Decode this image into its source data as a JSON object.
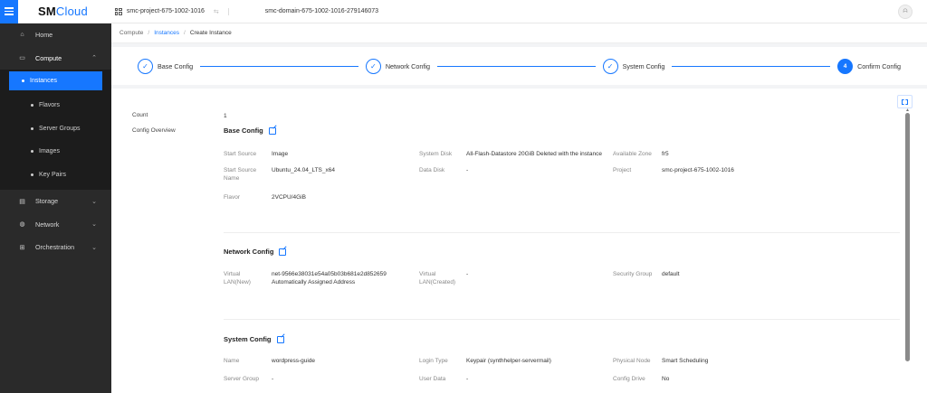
{
  "app": {
    "brand_bold": "SM",
    "brand_light": "Cloud"
  },
  "topbar": {
    "project": "smc-project-675-1002-1016",
    "domain": "smc-domain-675-1002-1016-279146073",
    "swap_glyph": "⇆",
    "sep_glyph": "|",
    "avatar_glyph": "ᗩ"
  },
  "sidebar": {
    "home": "Home",
    "compute": "Compute",
    "compute_items": [
      "Instances",
      "Flavors",
      "Server Groups",
      "Images",
      "Key Pairs"
    ],
    "storage": "Storage",
    "network": "Network",
    "orchestration": "Orchestration",
    "chev_up": "⌃",
    "chev_down": "⌄"
  },
  "breadcrumb": {
    "root": "Compute",
    "link": "Instances",
    "current": "Create Instance",
    "sep": "/"
  },
  "steps": [
    {
      "label": "Base Config",
      "mark": "✓"
    },
    {
      "label": "Network Config",
      "mark": "✓"
    },
    {
      "label": "System Config",
      "mark": "✓"
    },
    {
      "label": "Confirm Config",
      "mark": "4"
    }
  ],
  "summary": {
    "count_label": "Count",
    "count_value": "1",
    "overview_label": "Config Overview"
  },
  "base_config": {
    "title": "Base Config",
    "start_source_label": "Start Source",
    "start_source_value": "Image",
    "start_source_name_label": "Start Source Name",
    "start_source_name_value": "Ubuntu_24.04_LTS_x64",
    "flavor_label": "Flavor",
    "flavor_value": "2VCPU/4GiB",
    "system_disk_label": "System Disk",
    "system_disk_value": "All-Flash-Datastore 20GiB Deleted with the instance",
    "data_disk_label": "Data Disk",
    "data_disk_value": "-",
    "available_zone_label": "Available Zone",
    "available_zone_value": "fr5",
    "project_label": "Project",
    "project_value": "smc-project-675-1002-1016"
  },
  "network_config": {
    "title": "Network Config",
    "vlan_new_label": "Virtual LAN(New)",
    "vlan_new_value": "net-9566e38031e54a05b03b681e2d852659",
    "vlan_new_value2": "Automatically Assigned Address",
    "vlan_created_label": "Virtual LAN(Created)",
    "vlan_created_value": "-",
    "security_group_label": "Security Group",
    "security_group_value": "default"
  },
  "system_config": {
    "title": "System Config",
    "name_label": "Name",
    "name_value": "wordpress-guide",
    "server_group_label": "Server Group",
    "server_group_value": "-",
    "login_type_label": "Login Type",
    "login_type_value": "Keypair (synthhelper-servermail)",
    "user_data_label": "User Data",
    "user_data_value": "-",
    "physical_node_label": "Physical Node",
    "physical_node_value": "Smart Scheduling",
    "config_drive_label": "Config Drive",
    "config_drive_value": "No"
  },
  "colors": {
    "primary": "#1677ff",
    "sidebar_bg": "#2a2a2a"
  }
}
